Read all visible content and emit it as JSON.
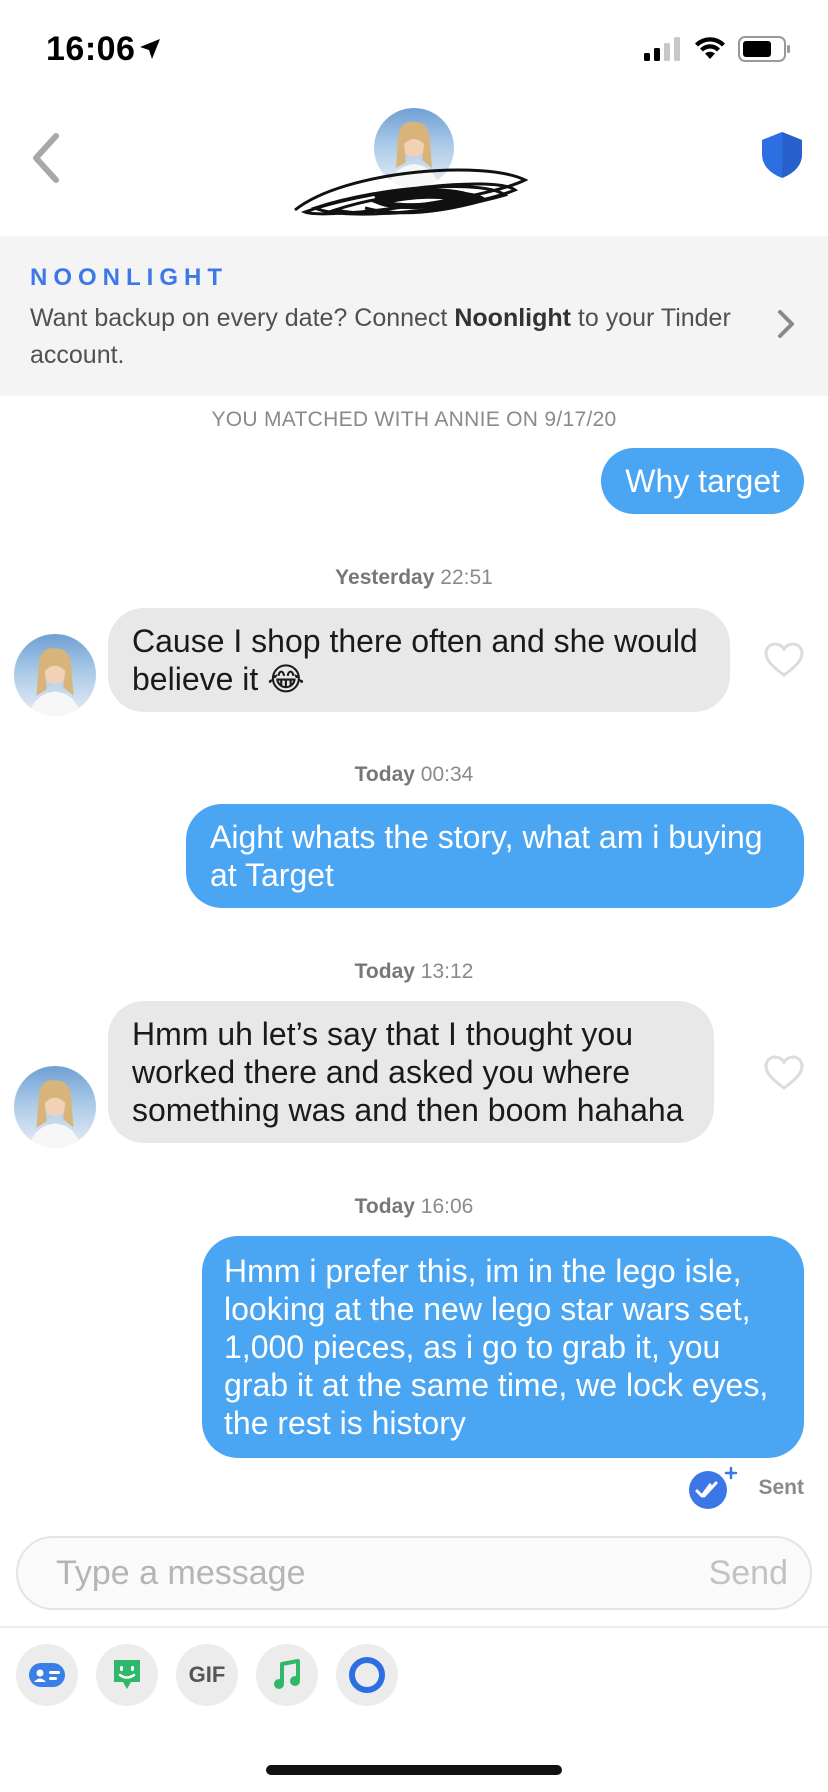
{
  "status_bar": {
    "time": "16:06"
  },
  "header": {
    "avatar_alt": "Annie"
  },
  "banner": {
    "logo": "NOONLIGHT",
    "text_before": "Want backup on every date? Connect ",
    "text_bold": "Noonlight",
    "text_after": " to your Tinder account."
  },
  "chat": {
    "match_note": "YOU MATCHED WITH ANNIE ON 9/17/20",
    "messages": [
      {
        "type": "out",
        "text": "Why target"
      },
      {
        "type": "stamp",
        "day": "Yesterday",
        "time": "22:51"
      },
      {
        "type": "in",
        "text": "Cause I shop there often and she would believe it 😂"
      },
      {
        "type": "stamp",
        "day": "Today",
        "time": "00:34"
      },
      {
        "type": "out",
        "text": "Aight whats the story, what am i buying at Target"
      },
      {
        "type": "stamp",
        "day": "Today",
        "time": "13:12"
      },
      {
        "type": "in",
        "text": "Hmm uh let’s say that I thought you worked there and asked you where something was and then boom hahaha"
      },
      {
        "type": "stamp",
        "day": "Today",
        "time": "16:06"
      },
      {
        "type": "out",
        "text": "Hmm i prefer this, im in the lego isle, looking at the new lego star wars set, 1,000 pieces, as i go to grab it, you grab it at the same time, we lock eyes, the rest is history"
      }
    ],
    "sent_label": "Sent"
  },
  "composer": {
    "placeholder": "Type a message",
    "send_label": "Send"
  },
  "toolbar": {
    "gif_label": "GIF",
    "tools": [
      "profile-card-icon",
      "sticker-icon",
      "gif-icon",
      "music-note-icon",
      "circle-icon"
    ]
  },
  "colors": {
    "outgoing_bubble": "#4aa5f3",
    "incoming_bubble": "#e8e8e8",
    "noonlight_blue": "#3e78e8",
    "shield_blue": "#2c6fe3"
  }
}
